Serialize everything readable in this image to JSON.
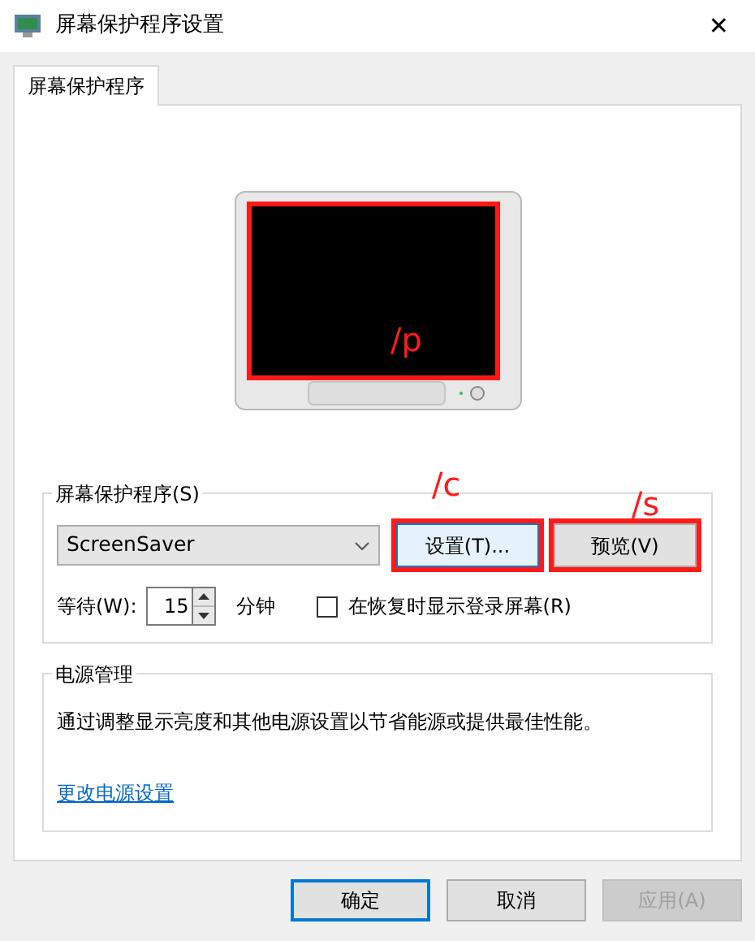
{
  "window": {
    "title": "屏幕保护程序设置",
    "close": "✕"
  },
  "tabs": [
    {
      "label": "屏幕保护程序",
      "selected": true
    }
  ],
  "preview": {
    "annotation": "/p"
  },
  "screensaver_group": {
    "title": "屏幕保护程序(S)",
    "dropdown": {
      "value": "ScreenSaver"
    },
    "buttons": [
      {
        "label": "设置(T)...",
        "annotation": "/c",
        "focused": true
      },
      {
        "label": "预览(V)",
        "annotation": "/s",
        "focused": false
      }
    ],
    "wait_label": "等待(W):",
    "wait_value": "15",
    "wait_unit": "分钟",
    "resume_checkbox": {
      "label": "在恢复时显示登录屏幕(R)",
      "checked": false
    }
  },
  "power_group": {
    "title": "电源管理",
    "description": "通过调整显示亮度和其他电源设置以节省能源或提供最佳性能。",
    "link": "更改电源设置"
  },
  "footer_buttons": [
    {
      "label": "确定",
      "default": true,
      "disabled": false
    },
    {
      "label": "取消",
      "default": false,
      "disabled": false
    },
    {
      "label": "应用(A)",
      "default": false,
      "disabled": true
    }
  ]
}
